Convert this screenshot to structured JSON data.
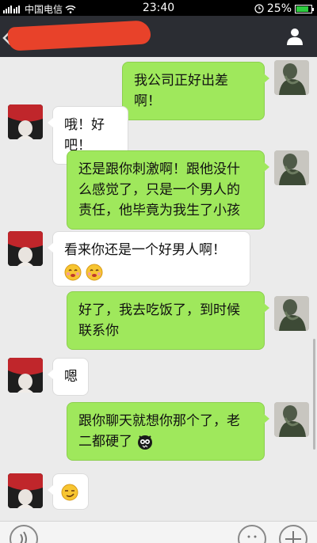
{
  "status_bar": {
    "carrier": "中国电信",
    "time": "23:40",
    "battery": "25%"
  },
  "header": {
    "contact_name_redacted": true,
    "back_icon": "back-arrow-icon",
    "profile_icon": "person-icon"
  },
  "messages": [
    {
      "side": "me",
      "text": "我公司正好出差啊！",
      "emoji_after": []
    },
    {
      "side": "them",
      "text": "哦！好吧！",
      "emoji_after": []
    },
    {
      "side": "me",
      "lines": [
        "还是跟你刺激啊！跟他没什",
        "么感觉了，只是一个男人的",
        "责任，他毕竟为我生了小孩"
      ],
      "emoji_after": []
    },
    {
      "side": "them",
      "text": "看来你还是一个好男人啊！",
      "emoji_after": [
        "blush-icon",
        "blush-icon"
      ]
    },
    {
      "side": "me",
      "lines": [
        "好了，我去吃饭了，到时候",
        "联系你"
      ],
      "emoji_after": []
    },
    {
      "side": "them",
      "text": "嗯",
      "emoji_after": []
    },
    {
      "side": "me",
      "lines": [
        "跟你聊天就想你那个了，老",
        "二都硬了"
      ],
      "emoji_after": [
        "monster-icon"
      ]
    },
    {
      "side": "them",
      "text": "",
      "emoji_after": [
        "smirk-icon"
      ]
    }
  ],
  "colors": {
    "sent_bubble": "#9fe85c",
    "received_bubble": "#ffffff",
    "background": "#ebebeb",
    "header": "#2b2d33"
  }
}
